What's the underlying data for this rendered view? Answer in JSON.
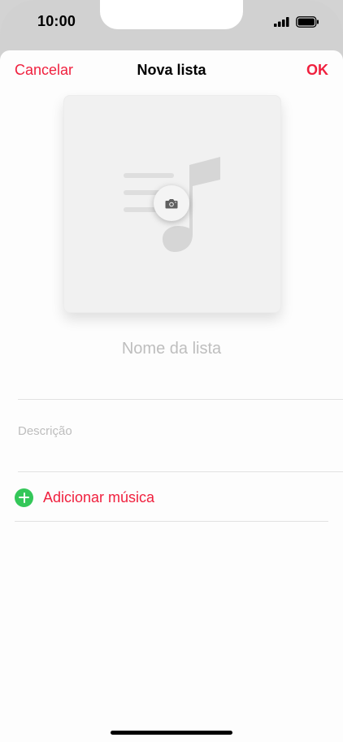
{
  "status_bar": {
    "time": "10:00",
    "signal_icon": "cellular-signal-icon",
    "battery_icon": "battery-icon"
  },
  "nav": {
    "cancel_label": "Cancelar",
    "title": "Nova lista",
    "ok_label": "OK"
  },
  "artwork": {
    "placeholder_icon": "music-playlist-icon",
    "camera_icon": "camera-icon"
  },
  "form": {
    "name_placeholder": "Nome da lista",
    "description_placeholder": "Descrição",
    "add_music_label": "Adicionar música",
    "add_icon": "plus-circle-icon"
  },
  "colors": {
    "accent": "#f0203e",
    "add_green": "#34c759",
    "placeholder": "#bebebe"
  }
}
